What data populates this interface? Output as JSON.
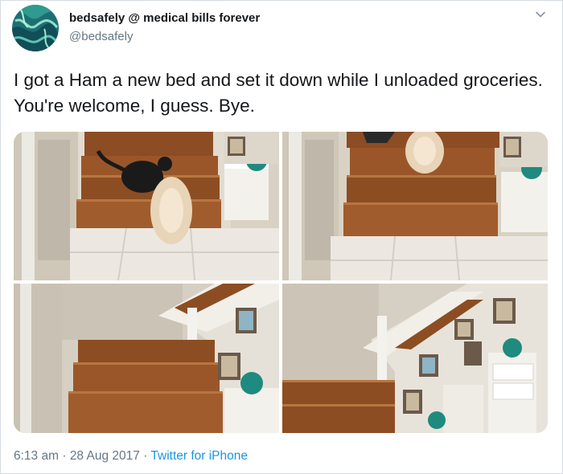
{
  "tweet": {
    "display_name": "bedsafely @ medical bills forever",
    "handle": "@bedsafely",
    "text": "I got a Ham a new bed and set it down while I unloaded groceries. You're welcome, I guess. Bye.",
    "time": "6:13 am",
    "separator": "·",
    "date": "28 Aug 2017",
    "source": "Twitter for iPhone"
  },
  "icons": {
    "menu": "chevron-down-icon",
    "avatar": "teal-swirl-avatar"
  },
  "colors": {
    "link": "#1b95e0",
    "muted": "#657786",
    "text": "#14171a"
  }
}
